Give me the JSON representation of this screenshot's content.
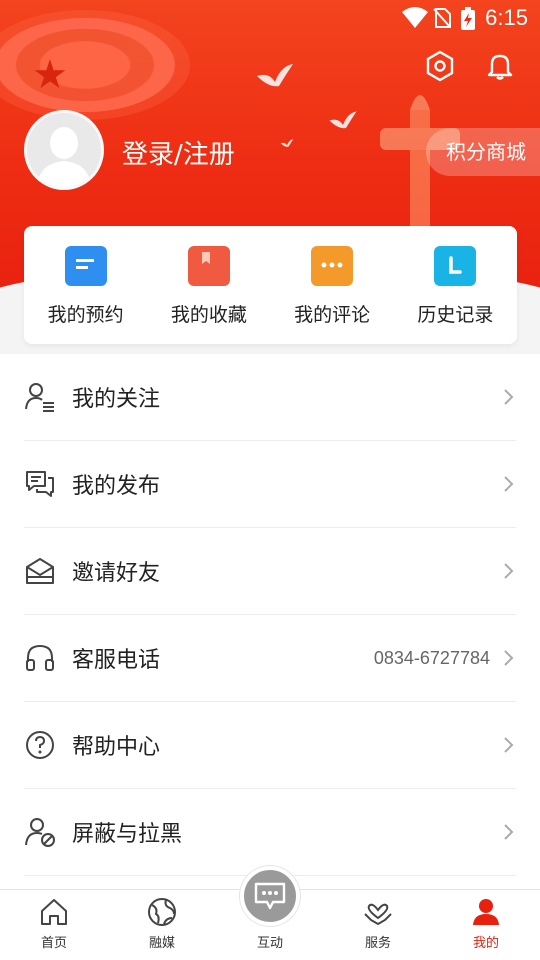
{
  "status_bar": {
    "time": "6:15"
  },
  "header": {
    "login_text": "登录/注册",
    "points_button": "积分商城",
    "settings_icon": "settings-hex-icon",
    "bell_icon": "bell-icon"
  },
  "quick_actions": [
    {
      "label": "我的预约",
      "icon": "reservation-icon",
      "color": "#2f8ff0"
    },
    {
      "label": "我的收藏",
      "icon": "favorite-icon",
      "color": "#ef5a40"
    },
    {
      "label": "我的评论",
      "icon": "comment-icon",
      "color": "#f39a2b"
    },
    {
      "label": "历史记录",
      "icon": "history-icon",
      "color": "#1ab3e6"
    }
  ],
  "menu": [
    {
      "label": "我的关注",
      "value": "",
      "icon": "follow-icon"
    },
    {
      "label": "我的发布",
      "value": "",
      "icon": "publish-icon"
    },
    {
      "label": "邀请好友",
      "value": "",
      "icon": "invite-icon"
    },
    {
      "label": "客服电话",
      "value": "0834-6727784",
      "icon": "headset-icon"
    },
    {
      "label": "帮助中心",
      "value": "",
      "icon": "help-icon"
    },
    {
      "label": "屏蔽与拉黑",
      "value": "",
      "icon": "block-user-icon"
    }
  ],
  "nav": [
    {
      "label": "首页",
      "icon": "home-icon"
    },
    {
      "label": "融媒",
      "icon": "globe-icon"
    },
    {
      "label": "互动",
      "icon": "chat-icon"
    },
    {
      "label": "服务",
      "icon": "service-icon"
    },
    {
      "label": "我的",
      "icon": "profile-icon",
      "active": true
    }
  ],
  "colors": {
    "brand": "#e8210f",
    "header_top": "#f3441e"
  }
}
